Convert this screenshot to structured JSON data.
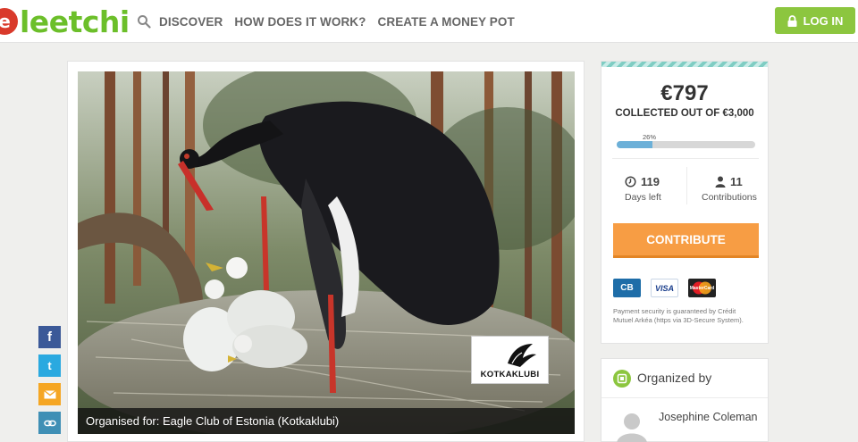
{
  "header": {
    "logo_mark": "e",
    "logo_text": "leetchi",
    "nav": [
      "DISCOVER",
      "HOW DOES IT WORK?",
      "CREATE A MONEY POT"
    ],
    "login_label": "LOG IN",
    "accent_color": "#8cc63f"
  },
  "media": {
    "caption": "Organised for: Eagle Club of Estonia (Kotkaklubi)",
    "watermark_text": "KOTKAKLUBI"
  },
  "social": [
    "facebook-icon",
    "twitter-icon",
    "email-icon",
    "link-icon"
  ],
  "stats": {
    "amount": "€797",
    "collected": "COLLECTED OUT OF €3,000",
    "percent_label": "26%",
    "progress_fraction": 0.26,
    "days_value": "119",
    "days_label": "Days left",
    "contrib_value": "11",
    "contrib_label": "Contributions",
    "contribute_label": "CONTRIBUTE",
    "payment": [
      "CB",
      "VISA",
      "MasterCard"
    ],
    "security_note": "Payment security is guaranteed by Crédit Mutuel Arkéa (https via 3D-Secure System)."
  },
  "organizer": {
    "title": "Organized by",
    "name": "Josephine Coleman"
  }
}
